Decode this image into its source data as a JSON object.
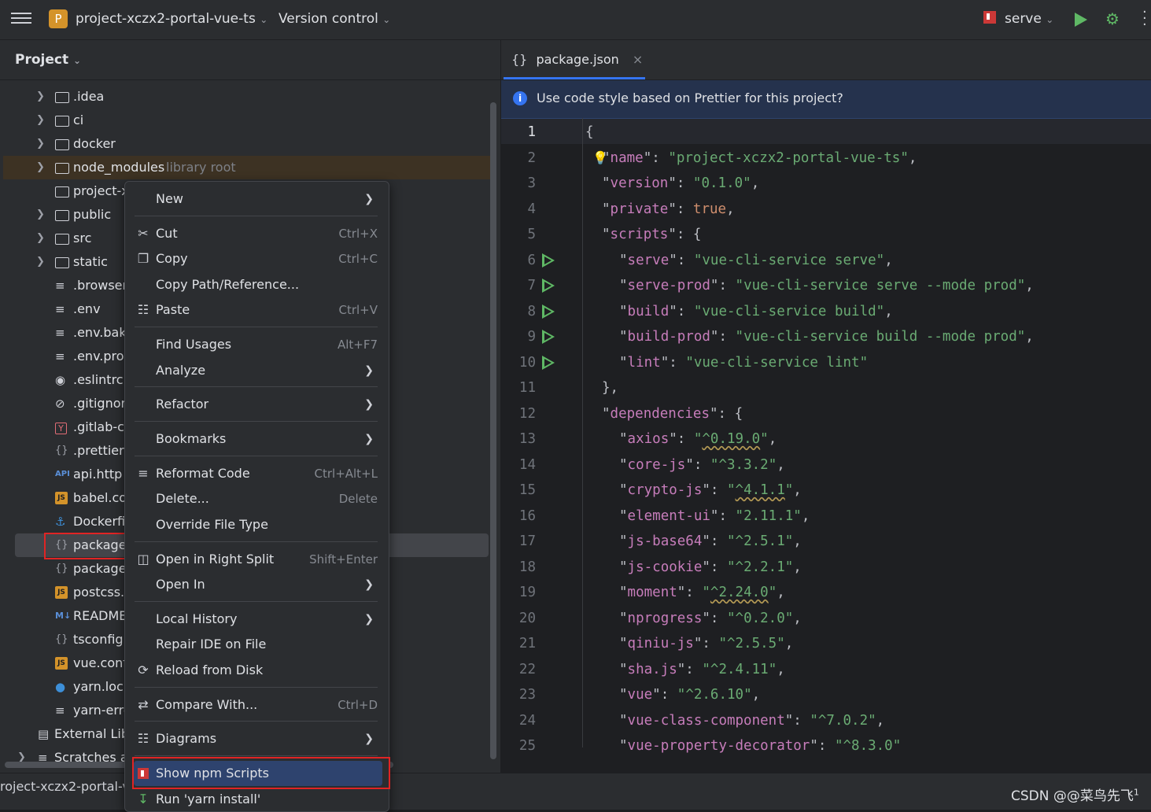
{
  "titlebar": {
    "project_badge": "P",
    "project_name": "project-xczx2-portal-vue-ts",
    "version_control": "Version control",
    "run_config": "serve"
  },
  "project_panel": {
    "header": "Project",
    "items": [
      {
        "label": ".idea",
        "icon": "folder-icon",
        "expandable": true
      },
      {
        "label": "ci",
        "icon": "folder-icon",
        "expandable": true
      },
      {
        "label": "docker",
        "icon": "folder-icon",
        "expandable": true
      },
      {
        "label": "node_modules",
        "suffix": "library root",
        "icon": "folder-icon",
        "expandable": true
      },
      {
        "label": "project-x",
        "icon": "folder-icon",
        "expandable": false
      },
      {
        "label": "public",
        "icon": "folder-icon",
        "expandable": true
      },
      {
        "label": "src",
        "icon": "folder-icon",
        "expandable": true
      },
      {
        "label": "static",
        "icon": "folder-icon",
        "expandable": true
      },
      {
        "label": ".browser",
        "icon": "text-file-icon"
      },
      {
        "label": ".env",
        "icon": "text-file-icon"
      },
      {
        "label": ".env.bak",
        "icon": "text-file-icon"
      },
      {
        "label": ".env.prod",
        "icon": "text-file-icon"
      },
      {
        "label": ".eslintrc.",
        "icon": "eslint-icon"
      },
      {
        "label": ".gitignor",
        "icon": "gitignore-icon"
      },
      {
        "label": ".gitlab-c",
        "icon": "yaml-icon"
      },
      {
        "label": ".prettierr",
        "icon": "json-icon"
      },
      {
        "label": "api.http",
        "icon": "api-icon"
      },
      {
        "label": "babel.co",
        "icon": "js-icon"
      },
      {
        "label": "Dockerfi",
        "icon": "docker-icon"
      },
      {
        "label": "package",
        "icon": "json-icon"
      },
      {
        "label": "package",
        "icon": "json-icon"
      },
      {
        "label": "postcss.",
        "icon": "js-icon"
      },
      {
        "label": "README",
        "icon": "markdown-icon"
      },
      {
        "label": "tsconfig",
        "icon": "json-icon"
      },
      {
        "label": "vue.conf",
        "icon": "js-icon"
      },
      {
        "label": "yarn.lock",
        "icon": "yarn-icon"
      },
      {
        "label": "yarn-erro",
        "icon": "text-file-icon"
      }
    ],
    "external_libraries": "External Lib",
    "scratches": "Scratches a"
  },
  "editor": {
    "tab_label": "package.json",
    "banner_text": "Use code style based on Prettier for this project?",
    "lines": [
      {
        "n": "1",
        "text": "{"
      },
      {
        "n": "2",
        "key": "name",
        "val": "project-xczx2-portal-vue-ts"
      },
      {
        "n": "3",
        "key": "version",
        "val": "0.1.0"
      },
      {
        "n": "4",
        "key": "private",
        "bool": "true"
      },
      {
        "n": "5",
        "key": "scripts",
        "open": "{"
      },
      {
        "n": "6",
        "key": "serve",
        "val": "vue-cli-service serve",
        "run": true
      },
      {
        "n": "7",
        "key": "serve-prod",
        "val": "vue-cli-service serve --mode prod",
        "run": true
      },
      {
        "n": "8",
        "key": "build",
        "val": "vue-cli-service build",
        "run": true
      },
      {
        "n": "9",
        "key": "build-prod",
        "val": "vue-cli-service build --mode prod",
        "run": true
      },
      {
        "n": "10",
        "key": "lint",
        "val": "vue-cli-service lint",
        "run": true
      },
      {
        "n": "11",
        "text": "},"
      },
      {
        "n": "12",
        "key": "dependencies",
        "open": "{"
      },
      {
        "n": "13",
        "key": "axios",
        "val": "^0.19.0"
      },
      {
        "n": "14",
        "key": "core-js",
        "val": "^3.3.2"
      },
      {
        "n": "15",
        "key": "crypto-js",
        "val": "^4.1.1"
      },
      {
        "n": "16",
        "key": "element-ui",
        "val": "2.11.1"
      },
      {
        "n": "17",
        "key": "js-base64",
        "val": "^2.5.1"
      },
      {
        "n": "18",
        "key": "js-cookie",
        "val": "^2.2.1"
      },
      {
        "n": "19",
        "key": "moment",
        "val": "^2.24.0"
      },
      {
        "n": "20",
        "key": "nprogress",
        "val": "^0.2.0"
      },
      {
        "n": "21",
        "key": "qiniu-js",
        "val": "^2.5.5"
      },
      {
        "n": "22",
        "key": "sha.js",
        "val": "^2.4.11"
      },
      {
        "n": "23",
        "key": "vue",
        "val": "^2.6.10"
      },
      {
        "n": "24",
        "key": "vue-class-component",
        "val": "^7.0.2"
      },
      {
        "n": "25",
        "key": "vue-property-decorator",
        "val": "^8.3.0"
      }
    ]
  },
  "context_menu": {
    "items": [
      {
        "label": "New",
        "submenu": true
      },
      {
        "label": "Cut",
        "shortcut": "Ctrl+X",
        "icon": "scissors-icon"
      },
      {
        "label": "Copy",
        "shortcut": "Ctrl+C",
        "icon": "copy-icon"
      },
      {
        "label": "Copy Path/Reference..."
      },
      {
        "label": "Paste",
        "shortcut": "Ctrl+V",
        "icon": "paste-icon"
      },
      {
        "label": "Find Usages",
        "shortcut": "Alt+F7"
      },
      {
        "label": "Analyze",
        "submenu": true
      },
      {
        "label": "Refactor",
        "submenu": true
      },
      {
        "label": "Bookmarks",
        "submenu": true
      },
      {
        "label": "Reformat Code",
        "shortcut": "Ctrl+Alt+L",
        "icon": "reformat-icon"
      },
      {
        "label": "Delete...",
        "shortcut": "Delete"
      },
      {
        "label": "Override File Type"
      },
      {
        "label": "Open in Right Split",
        "shortcut": "Shift+Enter",
        "icon": "split-icon"
      },
      {
        "label": "Open In",
        "submenu": true
      },
      {
        "label": "Local History",
        "submenu": true
      },
      {
        "label": "Repair IDE on File"
      },
      {
        "label": "Reload from Disk",
        "icon": "reload-icon"
      },
      {
        "label": "Compare With...",
        "shortcut": "Ctrl+D",
        "icon": "compare-icon"
      },
      {
        "label": "Diagrams",
        "submenu": true,
        "icon": "diagram-icon"
      },
      {
        "label": "Show npm Scripts",
        "icon": "npm-icon"
      },
      {
        "label": "Run 'yarn install'",
        "icon": "yarn-install-icon"
      }
    ]
  },
  "statusbar": {
    "path": "roject-xczx2-portal-v",
    "watermark": "CSDN @@菜鸟先飞",
    "watermark_sup": "1"
  },
  "colors": {
    "background": "#1e1f22",
    "panel": "#2b2d30",
    "accent": "#3574f0",
    "highlight_red": "#e02424",
    "string": "#6aab73",
    "key": "#c77dbb",
    "keyword": "#cf8e6d"
  }
}
